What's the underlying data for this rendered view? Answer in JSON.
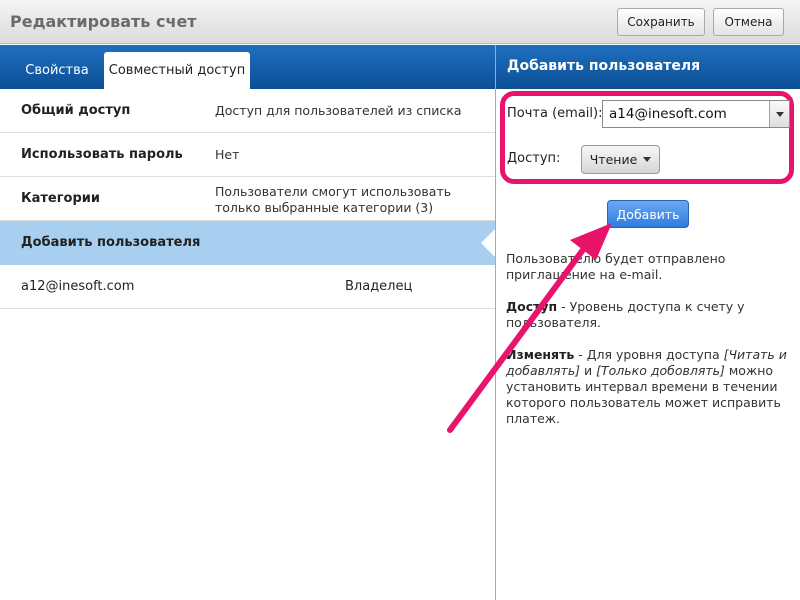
{
  "window": {
    "title": "Редактировать счет",
    "save_label": "Сохранить",
    "cancel_label": "Отмена"
  },
  "tabs": [
    {
      "label": "Свойства",
      "active": false
    },
    {
      "label": "Совместный доступ",
      "active": true
    }
  ],
  "rows": [
    {
      "key": "Общий доступ",
      "value": "Доступ для пользователей из списка"
    },
    {
      "key": "Использовать пароль",
      "value": "Нет"
    },
    {
      "key": "Категории",
      "value": "Пользователи смогут использовать только выбранные категории (3)"
    },
    {
      "key": "Добавить пользователя",
      "value": ""
    }
  ],
  "users": [
    {
      "email": "a12@inesoft.com",
      "role": "Владелец"
    }
  ],
  "add_user_panel": {
    "title": "Добавить пользователя",
    "email_label": "Почта (email):",
    "email_value": "a14@inesoft.com",
    "access_label": "Доступ:",
    "access_value": "Чтение",
    "add_button": "Добавить",
    "help": {
      "p1": "Пользователю будет отправлено приглашение на e-mail.",
      "p2_bold": "Доступ",
      "p2_rest": " - Уровень доступа к счету у пользователя.",
      "p3_bold": "Изменять",
      "p3_a": " - Для уровня доступа ",
      "p3_i1": "[Читать и добавлять]",
      "p3_b": " и ",
      "p3_i2": "[Только добовлять]",
      "p3_c": " можно установить интервал времени в течении которого пользователь может исправить платеж."
    }
  },
  "colors": {
    "header_blue": "#0c4f95",
    "selected_row": "#a8cff0",
    "highlight": "#e8146b",
    "add_button": "#2f7ce0"
  }
}
